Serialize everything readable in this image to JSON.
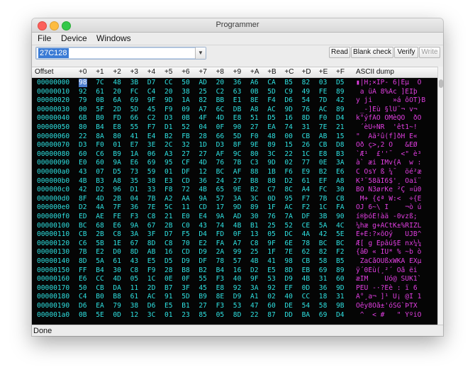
{
  "window": {
    "title": "Programmer"
  },
  "menu": [
    "File",
    "Device",
    "Windows"
  ],
  "toolbar": {
    "device": "27C128",
    "buttons": [
      {
        "label": "Read",
        "enabled": true
      },
      {
        "label": "Blank check",
        "enabled": true
      },
      {
        "label": "Verify",
        "enabled": true
      },
      {
        "label": "Write",
        "enabled": false
      }
    ]
  },
  "table": {
    "headers": [
      "Offset",
      "+0",
      "+1",
      "+2",
      "+3",
      "+4",
      "+5",
      "+6",
      "+7",
      "+8",
      "+9",
      "+A",
      "+B",
      "+C",
      "+D",
      "+E",
      "+F",
      "ASCII dump"
    ],
    "rows": [
      {
        "offset": "00000000",
        "bytes": [
          "98",
          "7C",
          "48",
          "3B",
          "D7",
          "CC",
          "50",
          "AD",
          "20",
          "36",
          "A6",
          "CA",
          "B5",
          "82",
          "03",
          "D5"
        ],
        "ascii": "▮|H;×ÌP- 6|Êµ  Õ"
      },
      {
        "offset": "00000010",
        "bytes": [
          "92",
          "61",
          "20",
          "FC",
          "C4",
          "20",
          "38",
          "25",
          "C2",
          "63",
          "0B",
          "5D",
          "C9",
          "49",
          "FE",
          "89"
        ],
        "ascii": " a üÄ 8%Âc ]ÉIþ"
      },
      {
        "offset": "00000020",
        "bytes": [
          "79",
          "0B",
          "6A",
          "69",
          "9F",
          "9D",
          "1A",
          "82",
          "BB",
          "E1",
          "8E",
          "F4",
          "D6",
          "54",
          "7D",
          "42"
        ],
        "ascii": "y ji     »á ôÖT}B"
      },
      {
        "offset": "00000030",
        "bytes": [
          "00",
          "5F",
          "2D",
          "5D",
          "45",
          "F9",
          "09",
          "A7",
          "6C",
          "DB",
          "A8",
          "AC",
          "9D",
          "76",
          "AC",
          "89"
        ],
        "ascii": " _-]Eù §lÛ¨¬ v¬ "
      },
      {
        "offset": "00000040",
        "bytes": [
          "6B",
          "B0",
          "FD",
          "66",
          "C2",
          "D3",
          "0B",
          "4F",
          "4D",
          "E8",
          "51",
          "D5",
          "16",
          "8D",
          "F0",
          "D4"
        ],
        "ascii": "k°ýfÂÓ OMèQÕ  ðÔ"
      },
      {
        "offset": "00000050",
        "bytes": [
          "80",
          "B4",
          "E8",
          "55",
          "F7",
          "D1",
          "52",
          "04",
          "0F",
          "90",
          "27",
          "EA",
          "74",
          "31",
          "7E",
          "21"
        ],
        "ascii": " ´èU÷ÑR  'êt1~!"
      },
      {
        "offset": "00000060",
        "bytes": [
          "22",
          "8A",
          "80",
          "41",
          "E4",
          "B2",
          "FB",
          "28",
          "66",
          "5D",
          "F0",
          "48",
          "00",
          "CB",
          "AB",
          "15"
        ],
        "ascii": "\"  Aä²û(f]ðH Ë« "
      },
      {
        "offset": "00000070",
        "bytes": [
          "D3",
          "F0",
          "01",
          "E7",
          "3E",
          "2C",
          "32",
          "1D",
          "D3",
          "8F",
          "9E",
          "89",
          "15",
          "26",
          "CB",
          "D8"
        ],
        "ascii": "Óð ç>,2 Ó   &ËØ"
      },
      {
        "offset": "00000080",
        "bytes": [
          "60",
          "C6",
          "B9",
          "1A",
          "06",
          "A3",
          "27",
          "27",
          "AF",
          "9C",
          "80",
          "3C",
          "22",
          "1C",
          "E8",
          "B3"
        ],
        "ascii": "`Æ¹  £''¯  <\" è³"
      },
      {
        "offset": "00000090",
        "bytes": [
          "E0",
          "60",
          "9A",
          "E6",
          "69",
          "95",
          "CF",
          "4D",
          "76",
          "7B",
          "C3",
          "9D",
          "02",
          "77",
          "0E",
          "3A"
        ],
        "ascii": "à` æi ÏMv{Ã  w :"
      },
      {
        "offset": "000000a0",
        "bytes": [
          "43",
          "07",
          "D5",
          "73",
          "59",
          "01",
          "DF",
          "12",
          "BC",
          "AF",
          "88",
          "1B",
          "F6",
          "E9",
          "B2",
          "E6"
        ],
        "ascii": "C ÕsY ß ¼¯  öé²æ"
      },
      {
        "offset": "000000b0",
        "bytes": [
          "4B",
          "B3",
          "A8",
          "35",
          "38",
          "E3",
          "CD",
          "36",
          "24",
          "27",
          "B8",
          "88",
          "D2",
          "61",
          "EF",
          "A8"
        ],
        "ascii": "K³¨58ãÍ6$'¸ Òaï¨"
      },
      {
        "offset": "000000c0",
        "bytes": [
          "42",
          "D2",
          "96",
          "D1",
          "33",
          "F8",
          "72",
          "4B",
          "65",
          "9E",
          "B2",
          "C7",
          "8C",
          "A4",
          "FC",
          "30"
        ],
        "ascii": "BÒ Ñ3ørKe ²Ç ¤ü0"
      },
      {
        "offset": "000000d0",
        "bytes": [
          "8F",
          "4D",
          "2B",
          "04",
          "7B",
          "A2",
          "AA",
          "9A",
          "57",
          "3A",
          "3C",
          "0D",
          "95",
          "F7",
          "7B",
          "CB"
        ],
        "ascii": " M+ {¢ª W:<  ÷{Ë"
      },
      {
        "offset": "000000e0",
        "bytes": [
          "D2",
          "4A",
          "7F",
          "36",
          "7E",
          "5C",
          "11",
          "CD",
          "17",
          "9D",
          "89",
          "1F",
          "AC",
          "F2",
          "1C",
          "FA"
        ],
        "ascii": "ÒJ 6~\\ Í    ¬ò ú"
      },
      {
        "offset": "000000f0",
        "bytes": [
          "ED",
          "AE",
          "FE",
          "F3",
          "C8",
          "21",
          "E0",
          "E4",
          "9A",
          "AD",
          "30",
          "76",
          "7A",
          "DF",
          "3B",
          "90"
        ],
        "ascii": "í®þóÈ!àä -0vzß; "
      },
      {
        "offset": "00000100",
        "bytes": [
          "BC",
          "68",
          "E6",
          "9A",
          "67",
          "2B",
          "C0",
          "43",
          "74",
          "4B",
          "B1",
          "25",
          "52",
          "CE",
          "5A",
          "4C"
        ],
        "ascii": "¼hæ g+ÀCtK±%RÎZL"
      },
      {
        "offset": "00000110",
        "bytes": [
          "CB",
          "2B",
          "C8",
          "3A",
          "3F",
          "D7",
          "F5",
          "D4",
          "FD",
          "0F",
          "13",
          "05",
          "DC",
          "4A",
          "42",
          "5E"
        ],
        "ascii": "Ë+È:?×õÔý   ÜJB^"
      },
      {
        "offset": "00000120",
        "bytes": [
          "C6",
          "5B",
          "1E",
          "67",
          "8D",
          "C8",
          "70",
          "E2",
          "FA",
          "A7",
          "C8",
          "9F",
          "6E",
          "78",
          "BC",
          "BC"
        ],
        "ascii": "Æ[ g Èpâú§È nx¼¼"
      },
      {
        "offset": "00000130",
        "bytes": [
          "7B",
          "E2",
          "D0",
          "8D",
          "AB",
          "16",
          "CD",
          "D9",
          "2A",
          "99",
          "25",
          "1F",
          "7E",
          "62",
          "82",
          "F2"
        ],
        "ascii": "{âÐ « ÍÙ* % ~b ò"
      },
      {
        "offset": "00000140",
        "bytes": [
          "8D",
          "5A",
          "61",
          "43",
          "E5",
          "D5",
          "D9",
          "DF",
          "78",
          "57",
          "4B",
          "41",
          "98",
          "CB",
          "58",
          "B5"
        ],
        "ascii": " ZaCåÕÙßxWKA ËXµ"
      },
      {
        "offset": "00000150",
        "bytes": [
          "FF",
          "B4",
          "30",
          "C8",
          "F9",
          "28",
          "B8",
          "B2",
          "B4",
          "16",
          "D2",
          "E5",
          "8D",
          "EB",
          "69",
          "89"
        ],
        "ascii": "ÿ´0Èù(¸²´ Òå ëi "
      },
      {
        "offset": "00000160",
        "bytes": [
          "E6",
          "CC",
          "4D",
          "05",
          "1C",
          "0E",
          "0F",
          "55",
          "F3",
          "40",
          "9F",
          "53",
          "D9",
          "4B",
          "31",
          "60"
        ],
        "ascii": "æÌM    Uó@ SÙK1`"
      },
      {
        "offset": "00000170",
        "bytes": [
          "50",
          "CB",
          "DA",
          "11",
          "2D",
          "B7",
          "3F",
          "45",
          "E8",
          "92",
          "3A",
          "92",
          "EF",
          "0D",
          "36",
          "9D"
        ],
        "ascii": "PËÚ -·?Eè : ï 6 "
      },
      {
        "offset": "00000180",
        "bytes": [
          "C4",
          "B0",
          "B8",
          "61",
          "AC",
          "91",
          "5D",
          "B9",
          "8E",
          "D9",
          "A1",
          "02",
          "40",
          "CC",
          "18",
          "31"
        ],
        "ascii": "Ä°¸a¬ ]¹ Ù¡ @Ì 1"
      },
      {
        "offset": "00000190",
        "bytes": [
          "D6",
          "EA",
          "79",
          "38",
          "D6",
          "E5",
          "B1",
          "27",
          "F3",
          "53",
          "47",
          "60",
          "DE",
          "54",
          "58",
          "9B"
        ],
        "ascii": "Öêy8Öå±'óSG`ÞTX "
      },
      {
        "offset": "000001a0",
        "bytes": [
          "0B",
          "5E",
          "0D",
          "12",
          "3C",
          "01",
          "23",
          "85",
          "05",
          "8D",
          "22",
          "87",
          "DD",
          "BA",
          "69",
          "D4"
        ],
        "ascii": " ^  < #   \" ÝºiÔ"
      }
    ]
  },
  "status": {
    "text": "Done"
  },
  "colors": {
    "hex_text": "#2ee0e0",
    "ascii_text": "#e03ee0",
    "grid_background": "#050505",
    "selection": "#4f7fcf"
  }
}
